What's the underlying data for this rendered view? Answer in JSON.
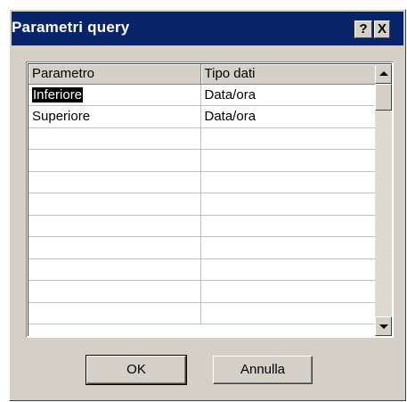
{
  "dialog": {
    "title": "Parametri query",
    "help_label": "?",
    "close_label": "X"
  },
  "grid": {
    "headers": [
      "Parametro",
      "Tipo dati"
    ],
    "rows": [
      {
        "param": "Inferiore",
        "type": "Data/ora",
        "selected": true
      },
      {
        "param": "Superiore",
        "type": "Data/ora",
        "selected": false
      },
      {
        "param": "",
        "type": ""
      },
      {
        "param": "",
        "type": ""
      },
      {
        "param": "",
        "type": ""
      },
      {
        "param": "",
        "type": ""
      },
      {
        "param": "",
        "type": ""
      },
      {
        "param": "",
        "type": ""
      },
      {
        "param": "",
        "type": ""
      },
      {
        "param": "",
        "type": ""
      },
      {
        "param": "",
        "type": ""
      }
    ]
  },
  "buttons": {
    "ok_label": "OK",
    "cancel_label": "Annulla"
  },
  "icons": {
    "scroll_up": "arrow-up-icon",
    "scroll_down": "arrow-down-icon"
  },
  "colors": {
    "title_bar": "#0a246a",
    "face": "#d4d0c8",
    "selection": "#000000"
  }
}
